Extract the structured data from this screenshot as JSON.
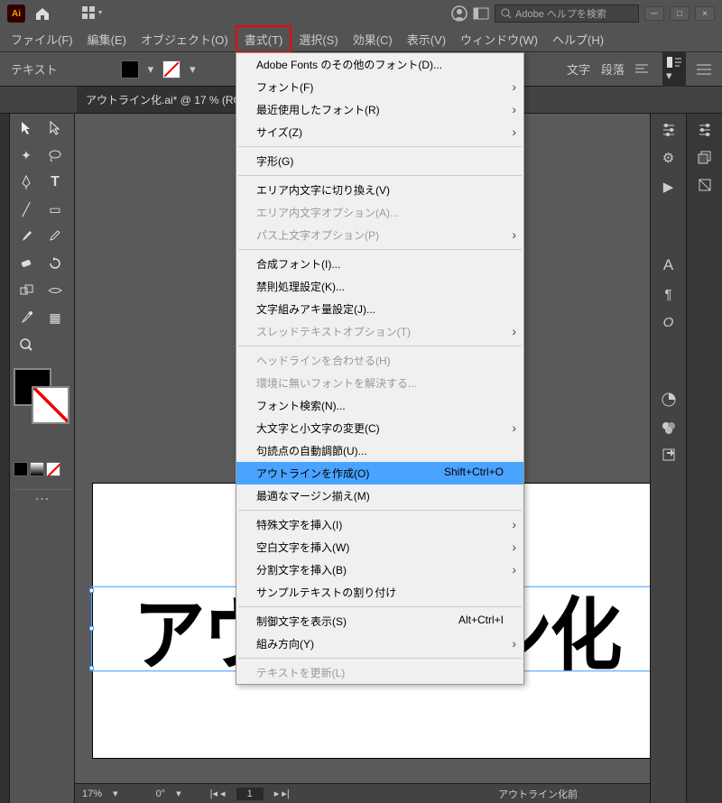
{
  "app": {
    "short": "Ai"
  },
  "search": {
    "placeholder": "Adobe ヘルプを検索"
  },
  "menubar": [
    "ファイル(F)",
    "編集(E)",
    "オブジェクト(O)",
    "書式(T)",
    "選択(S)",
    "効果(C)",
    "表示(V)",
    "ウィンドウ(W)",
    "ヘルプ(H)"
  ],
  "menubar_active_index": 3,
  "propbar": {
    "label": "テキスト",
    "right1": "文字",
    "right2": "段落"
  },
  "document": {
    "tab": "アウトライン化.ai* @ 17 % (RGB/プレビュー)",
    "text": "アウトライン化"
  },
  "status": {
    "zoom": "17%",
    "angle": "0°",
    "page": "1",
    "mode": "アウトライン化前"
  },
  "dropdown": [
    {
      "t": "item",
      "label": "Adobe Fonts のその他のフォント(D)..."
    },
    {
      "t": "item",
      "label": "フォント(F)",
      "sub": true
    },
    {
      "t": "item",
      "label": "最近使用したフォント(R)",
      "sub": true
    },
    {
      "t": "item",
      "label": "サイズ(Z)",
      "sub": true
    },
    {
      "t": "sep"
    },
    {
      "t": "item",
      "label": "字形(G)"
    },
    {
      "t": "sep"
    },
    {
      "t": "item",
      "label": "エリア内文字に切り換え(V)"
    },
    {
      "t": "item",
      "label": "エリア内文字オプション(A)...",
      "disabled": true
    },
    {
      "t": "item",
      "label": "パス上文字オプション(P)",
      "sub": true,
      "disabled": true
    },
    {
      "t": "sep"
    },
    {
      "t": "item",
      "label": "合成フォント(I)..."
    },
    {
      "t": "item",
      "label": "禁則処理設定(K)..."
    },
    {
      "t": "item",
      "label": "文字組みアキ量設定(J)..."
    },
    {
      "t": "item",
      "label": "スレッドテキストオプション(T)",
      "sub": true,
      "disabled": true
    },
    {
      "t": "sep"
    },
    {
      "t": "item",
      "label": "ヘッドラインを合わせる(H)",
      "disabled": true
    },
    {
      "t": "item",
      "label": "環境に無いフォントを解決する...",
      "disabled": true
    },
    {
      "t": "item",
      "label": "フォント検索(N)..."
    },
    {
      "t": "item",
      "label": "大文字と小文字の変更(C)",
      "sub": true
    },
    {
      "t": "item",
      "label": "句読点の自動調節(U)..."
    },
    {
      "t": "item",
      "label": "アウトラインを作成(O)",
      "shortcut": "Shift+Ctrl+O",
      "highlight": true
    },
    {
      "t": "item",
      "label": "最適なマージン揃え(M)"
    },
    {
      "t": "sep"
    },
    {
      "t": "item",
      "label": "特殊文字を挿入(I)",
      "sub": true
    },
    {
      "t": "item",
      "label": "空白文字を挿入(W)",
      "sub": true
    },
    {
      "t": "item",
      "label": "分割文字を挿入(B)",
      "sub": true
    },
    {
      "t": "item",
      "label": "サンプルテキストの割り付け"
    },
    {
      "t": "sep"
    },
    {
      "t": "item",
      "label": "制御文字を表示(S)",
      "shortcut": "Alt+Ctrl+I"
    },
    {
      "t": "item",
      "label": "組み方向(Y)",
      "sub": true
    },
    {
      "t": "sep"
    },
    {
      "t": "item",
      "label": "テキストを更新(L)",
      "disabled": true
    }
  ]
}
